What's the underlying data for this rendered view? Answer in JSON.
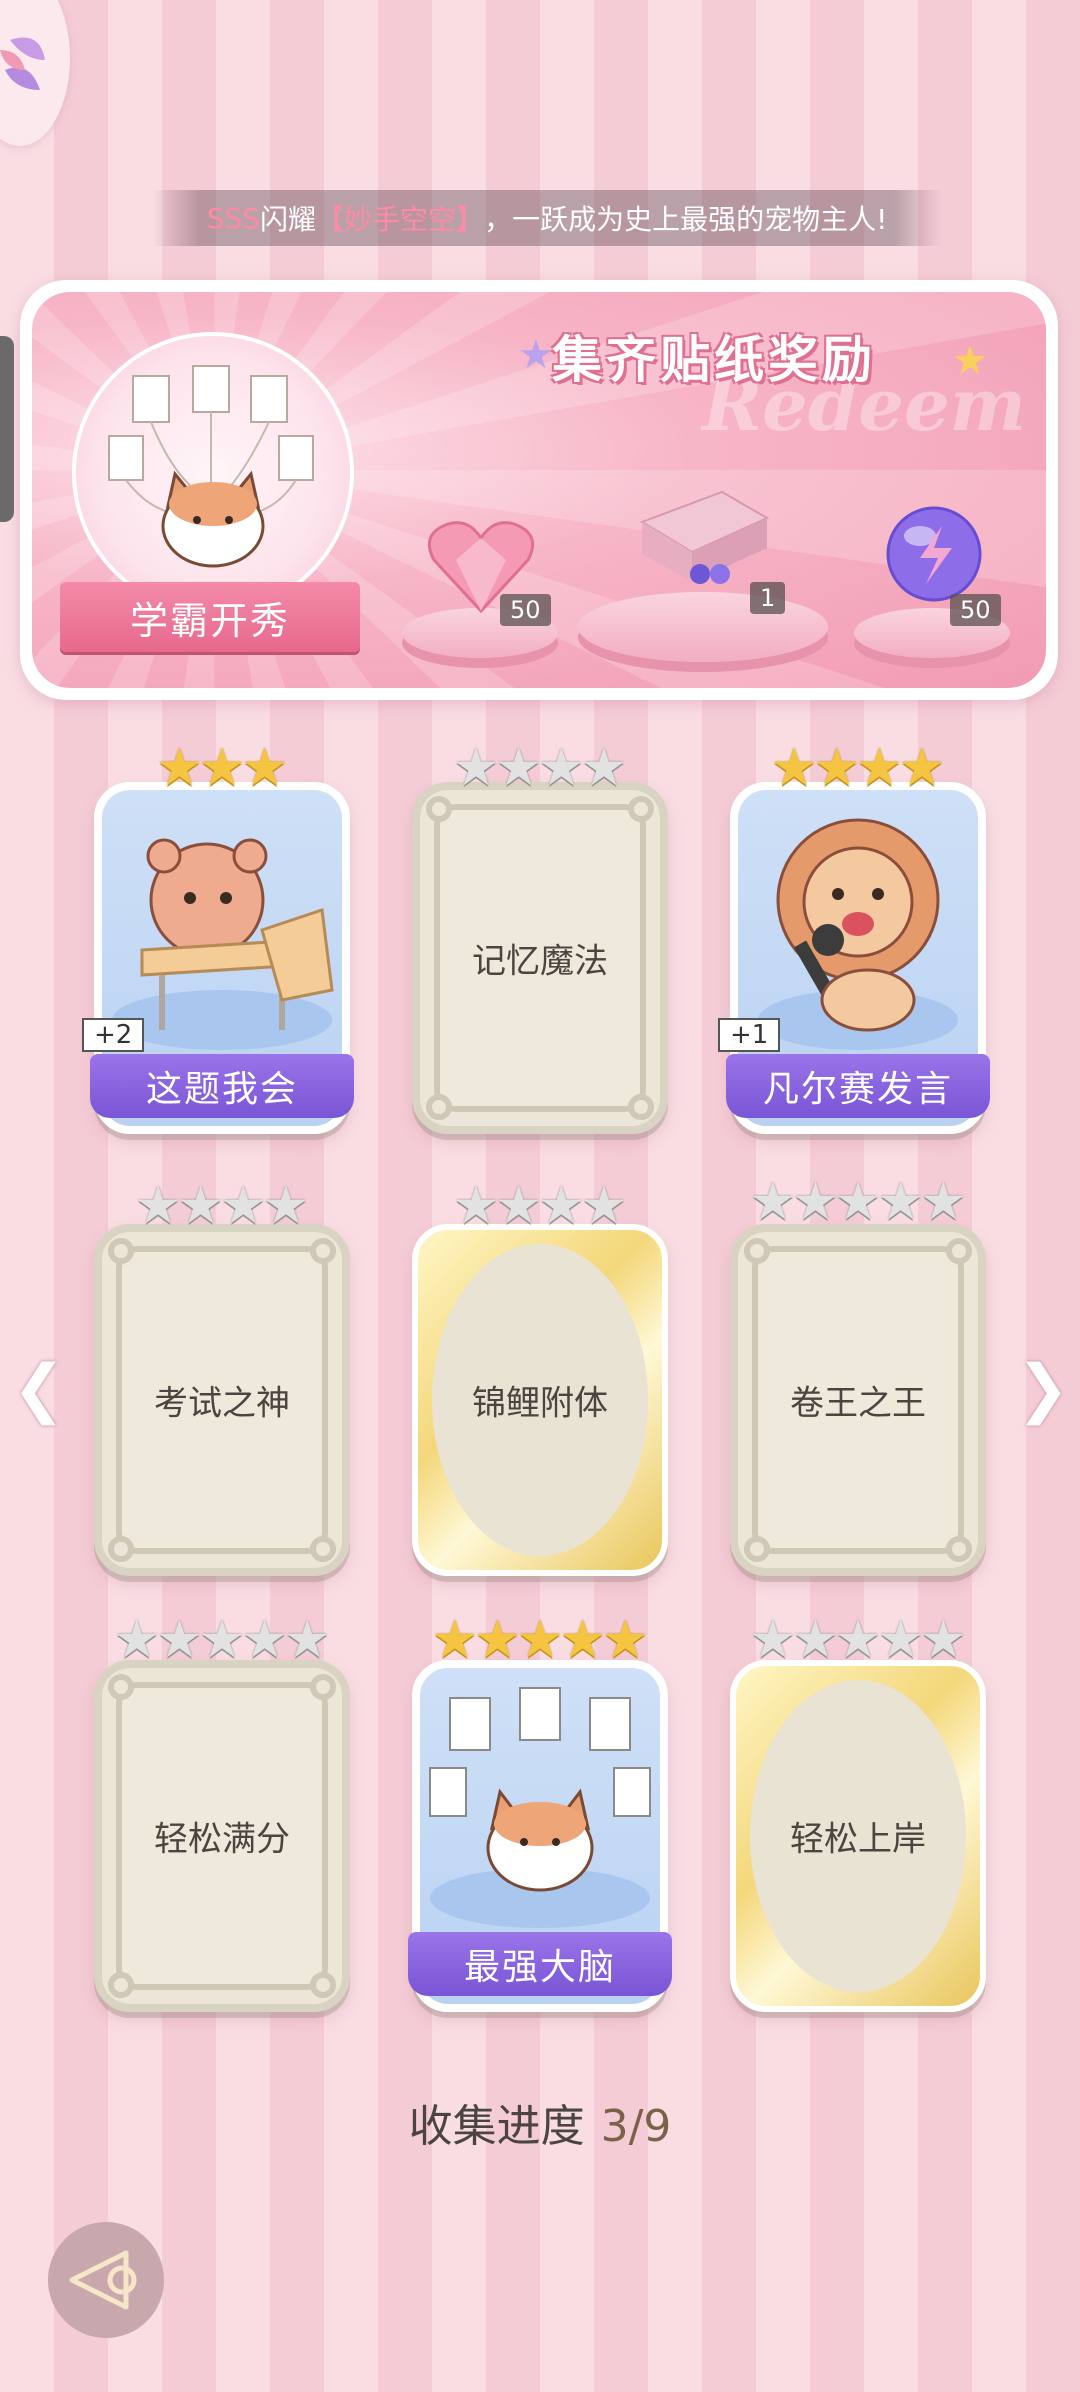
{
  "colors": {
    "accent": "#e6698c",
    "purple_label": "#7a55d6",
    "gold_star": "#f5c542"
  },
  "top": {
    "menu_icon": "pinwheel-icon",
    "marquee": {
      "prefix": "SSS",
      "mid": "闪耀",
      "highlight": "【妙手空空】",
      "suffix": "，一跃成为史上最强的宠物主人!"
    }
  },
  "reward": {
    "title": "集齐贴纸奖励",
    "watermark": "Redeem",
    "medal_label": "学霸开秀",
    "items": [
      {
        "icon": "pink-heart-gem-icon",
        "count": "50"
      },
      {
        "icon": "gift-box-icon",
        "count": "1"
      },
      {
        "icon": "purple-orb-icon",
        "count": "50"
      }
    ]
  },
  "cards": [
    {
      "title": "这题我会",
      "state": "collected",
      "stars": 3,
      "star_color": "gold",
      "plus": "+2",
      "art": "bear-at-desk"
    },
    {
      "title": "记忆魔法",
      "state": "locked",
      "stars": 4,
      "star_color": "grey"
    },
    {
      "title": "凡尔赛发言",
      "state": "collected",
      "stars": 4,
      "star_color": "gold",
      "plus": "+1",
      "art": "lion-with-mic"
    },
    {
      "title": "考试之神",
      "state": "locked",
      "stars": 4,
      "star_color": "grey"
    },
    {
      "title": "锦鲤附体",
      "state": "locked-gold",
      "stars": 4,
      "star_color": "grey"
    },
    {
      "title": "卷王之王",
      "state": "locked",
      "stars": 5,
      "star_color": "grey"
    },
    {
      "title": "轻松满分",
      "state": "locked",
      "stars": 5,
      "star_color": "grey"
    },
    {
      "title": "最强大脑",
      "state": "collected",
      "stars": 5,
      "star_color": "gold",
      "art": "cat-with-papers"
    },
    {
      "title": "轻松上岸",
      "state": "locked-gold",
      "stars": 5,
      "star_color": "grey"
    }
  ],
  "nav": {
    "prev_icon": "chevron-left-icon",
    "next_icon": "chevron-right-icon"
  },
  "progress": {
    "label": "收集进度",
    "value": "3/9"
  },
  "back": {
    "icon": "back-icon"
  }
}
